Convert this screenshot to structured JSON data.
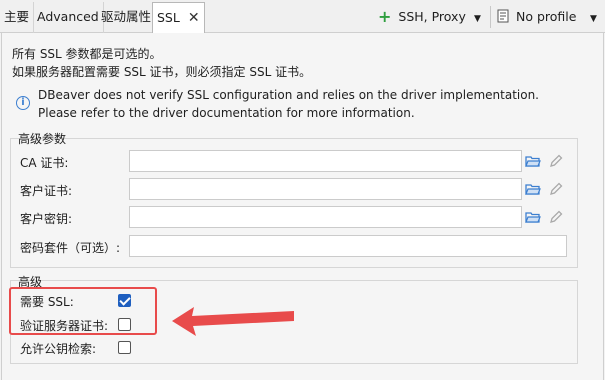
{
  "tabs": [
    {
      "label": "主要"
    },
    {
      "label": "Advanced"
    },
    {
      "label": "驱动属性"
    },
    {
      "label": "SSL",
      "close": "✕"
    }
  ],
  "toolbar": {
    "ssh_label": "SSH, Proxy",
    "profile_label": "No profile"
  },
  "intro": {
    "line1": "所有 SSL 参数都是可选的。",
    "line2": "如果服务器配置需要 SSL 证书，则必须指定 SSL 证书。"
  },
  "notice": {
    "line1": "DBeaver does not verify SSL configuration and relies on the driver implementation.",
    "line2": "Please refer to the driver documentation for more information."
  },
  "advanced_params": {
    "title": "高级参数",
    "fields": [
      {
        "label": "CA 证书:",
        "value": ""
      },
      {
        "label": "客户证书:",
        "value": ""
      },
      {
        "label": "客户密钥:",
        "value": ""
      },
      {
        "label": "密码套件（可选）:",
        "value": ""
      }
    ]
  },
  "advanced": {
    "title": "高级",
    "options": [
      {
        "label": "需要 SSL:",
        "checked": true
      },
      {
        "label": "验证服务器证书:",
        "checked": false
      },
      {
        "label": "允许公钥检索:",
        "checked": false
      }
    ]
  },
  "colors": {
    "accent": "#1f5fbf",
    "arrow": "#e84b4b",
    "folder": "#3c7fd0",
    "add": "#2e9e3e"
  }
}
